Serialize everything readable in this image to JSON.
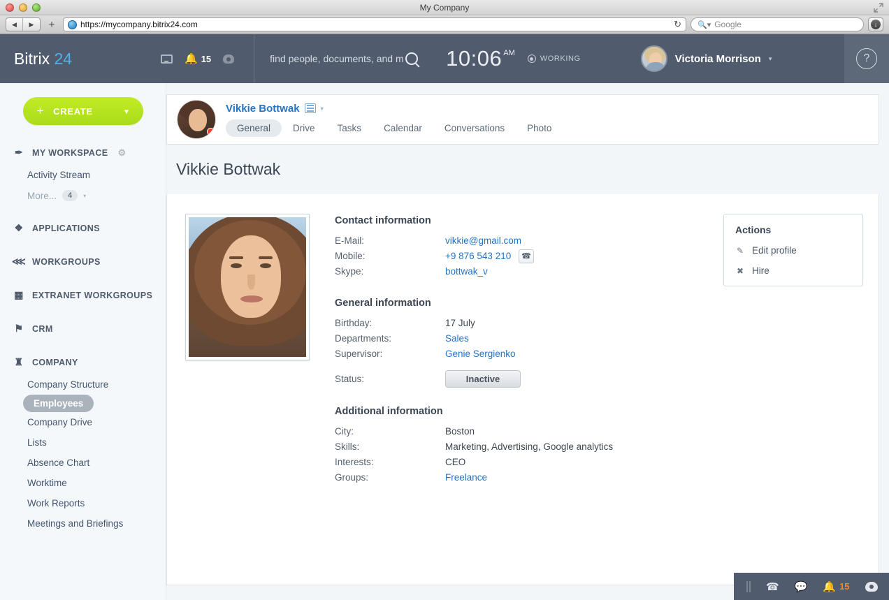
{
  "browser": {
    "window_title": "My Company",
    "url": "https://mycompany.bitrix24.com",
    "search_placeholder": "Google",
    "reload_icon": "reload-icon",
    "back_icon": "◀",
    "forward_icon": "▶",
    "new_tab_icon": "+",
    "download_icon": "download-icon",
    "fullscreen_icon": "fullscreen-icon"
  },
  "header": {
    "logo_main": "Bitrix",
    "logo_number": "24",
    "chat_icon": "chat-icon",
    "bell_icon": "🔔",
    "notification_count": "15",
    "cloud_icon": "cloud-icon",
    "search_placeholder": "find people, documents, and m",
    "search_icon": "search-icon",
    "clock_time": "10:06",
    "clock_ampm": "AM",
    "status_label": "WORKING",
    "user_name": "Victoria Morrison",
    "user_caret": "▾",
    "help_label": "?"
  },
  "sidebar": {
    "create_label": "CREATE",
    "create_plus": "+",
    "create_caret": "⌄",
    "groups": [
      {
        "label": "MY WORKSPACE",
        "icon": "pin-icon",
        "icon_glyph": "✒",
        "gear_icon": "gear-icon",
        "gear_glyph": "⚙",
        "items": [
          {
            "label": "Activity Stream",
            "type": "link"
          },
          {
            "label": "More...",
            "type": "more",
            "badge": "4",
            "caret": "▾"
          }
        ]
      },
      {
        "label": "APPLICATIONS",
        "icon": "applications-icon",
        "icon_glyph": "❖",
        "items": []
      },
      {
        "label": "WORKGROUPS",
        "icon": "share-icon",
        "icon_glyph": "≪",
        "items": []
      },
      {
        "label": "EXTRANET WORKGROUPS",
        "icon": "grid-icon",
        "icon_glyph": "▒",
        "items": []
      },
      {
        "label": "CRM",
        "icon": "flag-icon",
        "icon_glyph": "⚑",
        "items": []
      },
      {
        "label": "COMPANY",
        "icon": "company-icon",
        "icon_glyph": "♜",
        "items": [
          {
            "label": "Company Structure",
            "type": "link"
          },
          {
            "label": "Employees",
            "type": "link",
            "active": true
          },
          {
            "label": "Company Drive",
            "type": "link"
          },
          {
            "label": "Lists",
            "type": "link"
          },
          {
            "label": "Absence Chart",
            "type": "link"
          },
          {
            "label": "Worktime",
            "type": "link"
          },
          {
            "label": "Work Reports",
            "type": "link"
          },
          {
            "label": "Meetings and Briefings",
            "type": "link"
          }
        ]
      }
    ]
  },
  "profile_bar": {
    "name": "Vikkie Bottwak",
    "list_icon": "list-icon",
    "caret": "▾",
    "tabs": [
      {
        "label": "General",
        "active": true
      },
      {
        "label": "Drive",
        "active": false
      },
      {
        "label": "Tasks",
        "active": false
      },
      {
        "label": "Calendar",
        "active": false
      },
      {
        "label": "Conversations",
        "active": false
      },
      {
        "label": "Photo",
        "active": false
      }
    ]
  },
  "page": {
    "title": "Vikkie Bottwak",
    "photo_alt": "employee-photo"
  },
  "contact_information": {
    "heading": "Contact information",
    "rows": [
      {
        "label": "E-Mail:",
        "value": "vikkie@gmail.com",
        "link": true
      },
      {
        "label": "Mobile:",
        "value": "+9 876 543 210",
        "link": true,
        "action_icon": "phone-icon",
        "action_glyph": "☎"
      },
      {
        "label": "Skype:",
        "value": "bottwak_v",
        "link": true
      }
    ]
  },
  "general_information": {
    "heading": "General information",
    "rows": [
      {
        "label": "Birthday:",
        "value": "17 July",
        "link": false
      },
      {
        "label": "Departments:",
        "value": "Sales",
        "link": true
      },
      {
        "label": "Supervisor:",
        "value": "Genie Sergienko",
        "link": true
      }
    ],
    "status_label": "Status:",
    "status_value": "Inactive"
  },
  "additional_information": {
    "heading": "Additional information",
    "rows": [
      {
        "label": "City:",
        "value": "Boston",
        "link": false
      },
      {
        "label": "Skills:",
        "value": "Marketing, Advertising, Google analytics",
        "link": false
      },
      {
        "label": "Interests:",
        "value": "CEO",
        "link": false
      },
      {
        "label": "Groups:",
        "value": "Freelance",
        "link": true
      }
    ]
  },
  "actions": {
    "title": "Actions",
    "items": [
      {
        "label": "Edit profile",
        "icon": "pencil-icon",
        "glyph": "✎"
      },
      {
        "label": "Hire",
        "icon": "close-icon",
        "glyph": "✖"
      }
    ]
  },
  "dock": {
    "phone_icon": "phone-icon",
    "phone_glyph": "☎",
    "chat_icon": "chat-icon",
    "bell_icon": "🔔",
    "count": "15",
    "cloud_icon": "cloud-icon"
  },
  "colors": {
    "header_bg": "#505c6e",
    "accent_green": "#c2eb26",
    "link_blue": "#2474c4",
    "logo_blue": "#4eb3e8",
    "badge_orange": "#f08a1e"
  }
}
